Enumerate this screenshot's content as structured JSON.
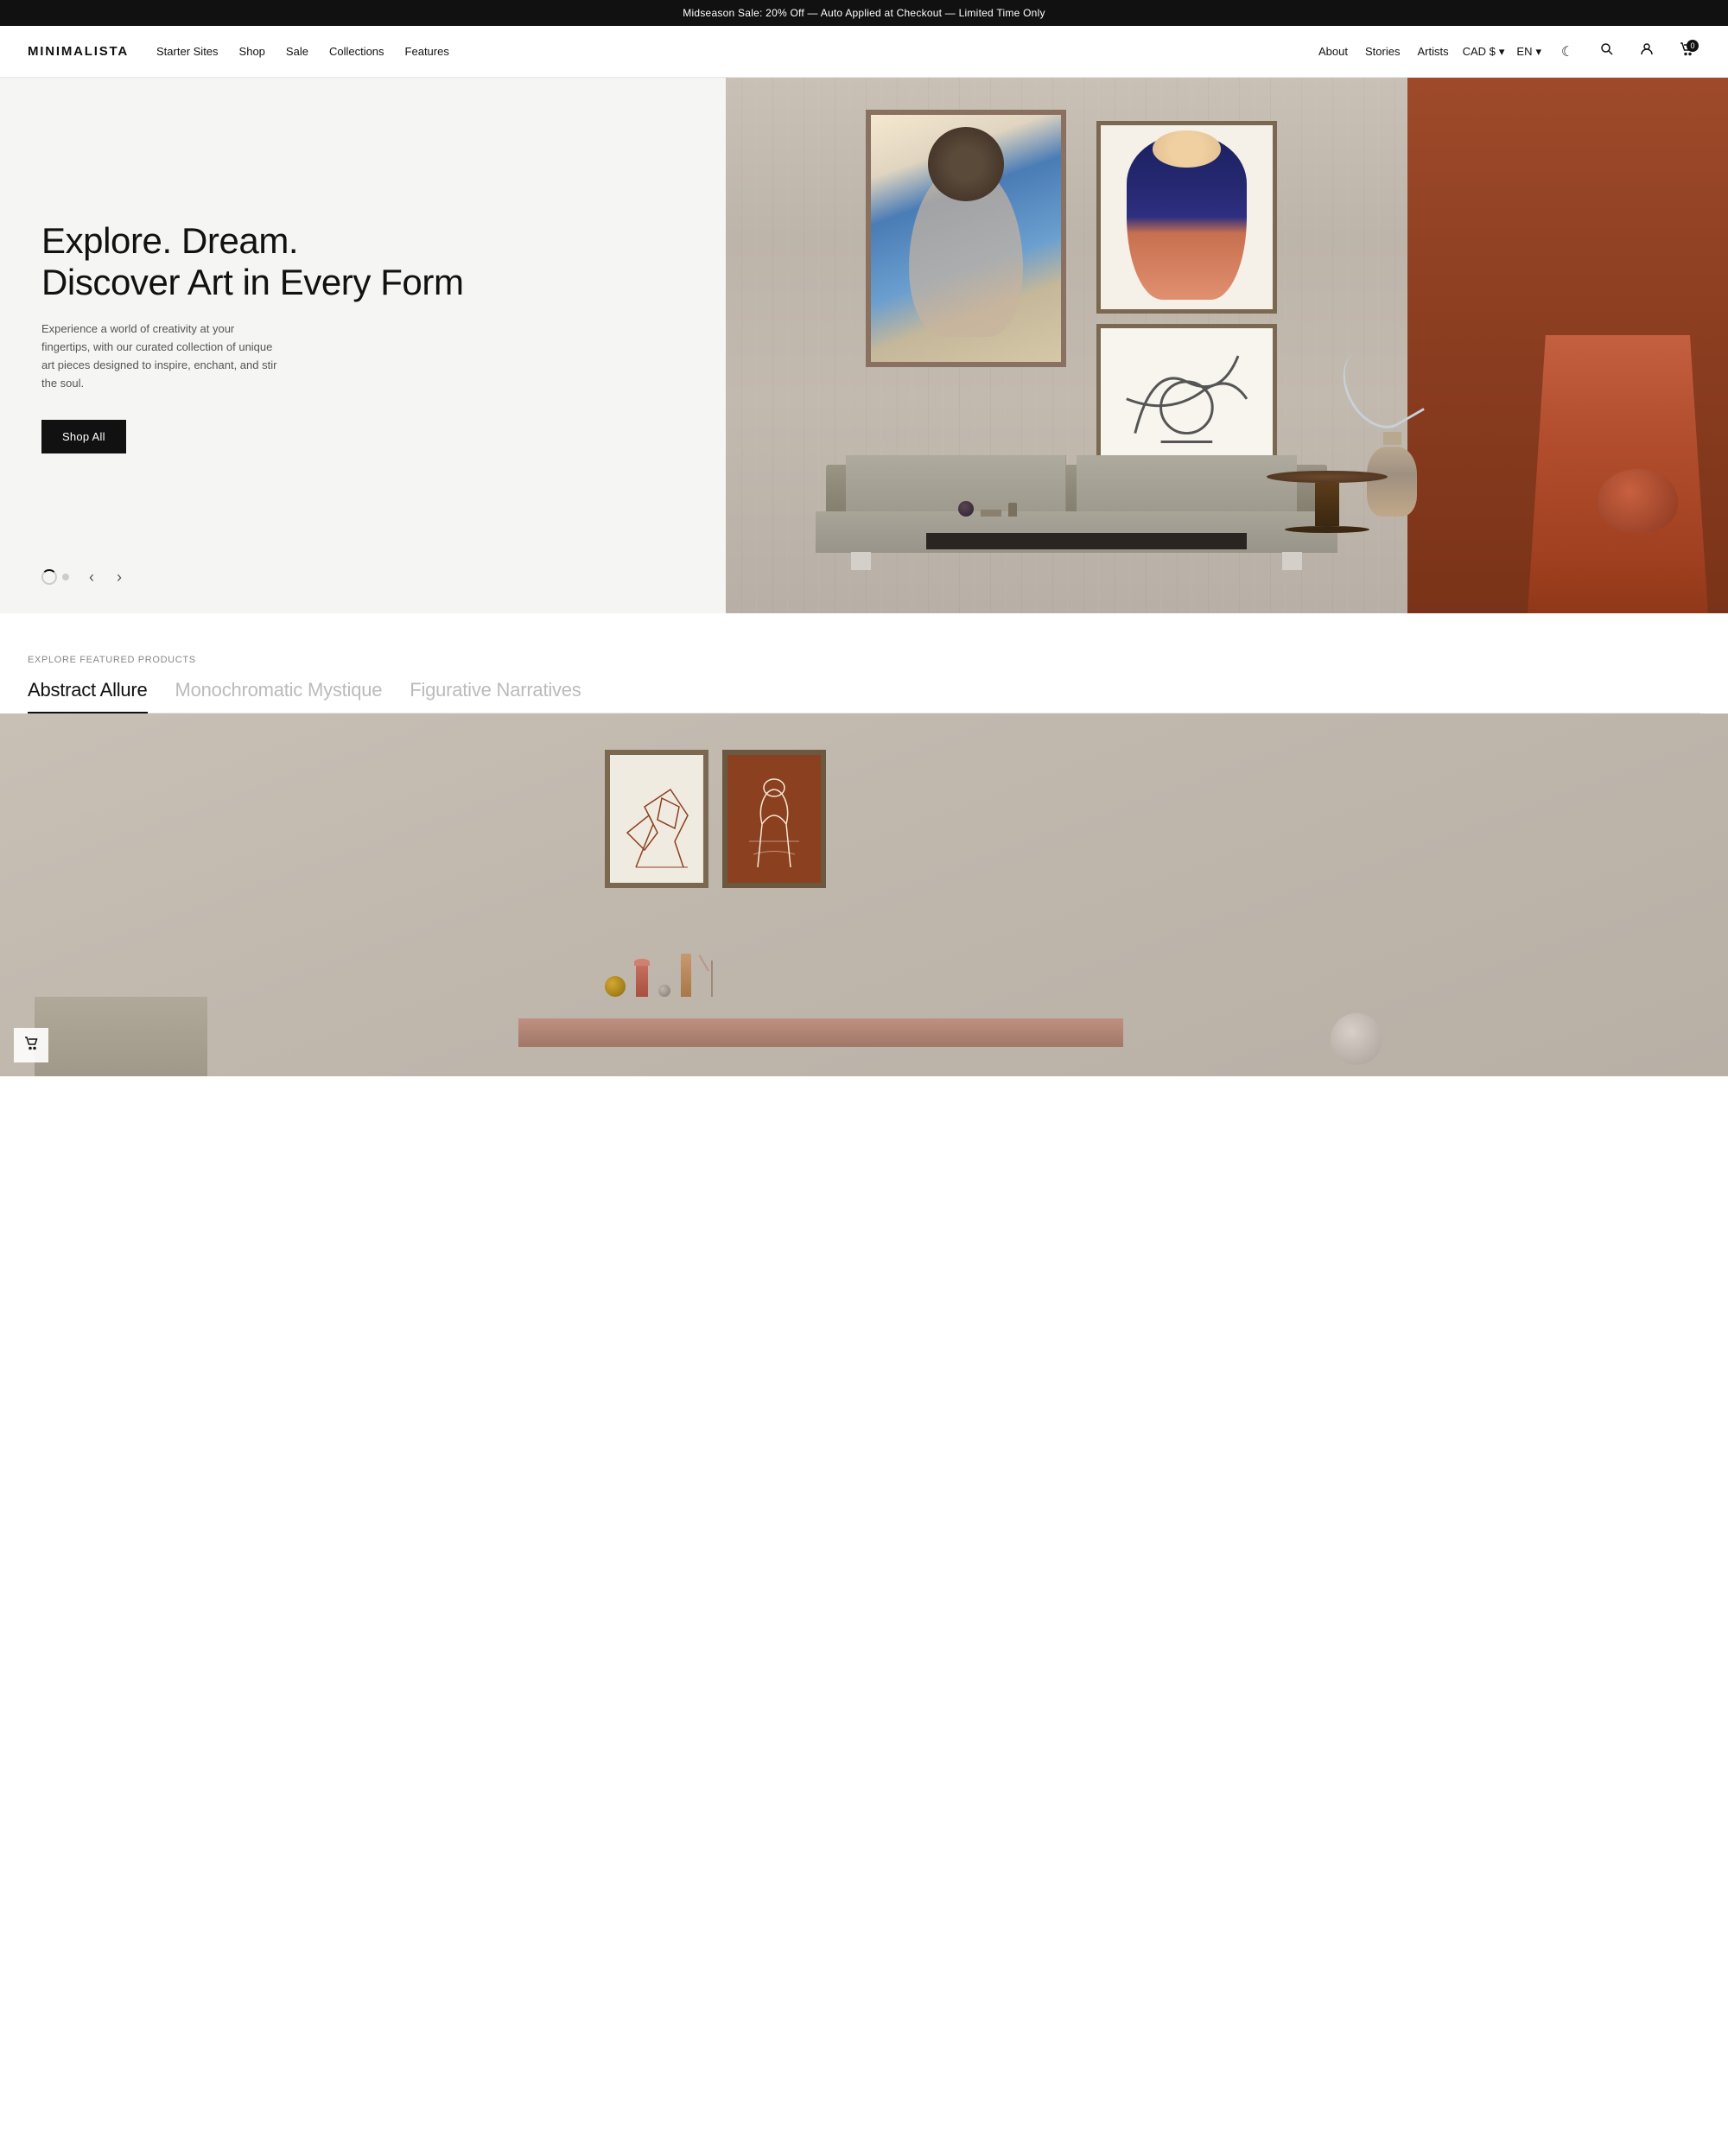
{
  "announcement": {
    "text": "Midseason Sale: 20% Off — Auto Applied at Checkout — Limited Time Only"
  },
  "header": {
    "logo": "MINIMALISTA",
    "nav": {
      "items": [
        {
          "id": "starter-sites",
          "label": "Starter Sites"
        },
        {
          "id": "shop",
          "label": "Shop"
        },
        {
          "id": "sale",
          "label": "Sale"
        },
        {
          "id": "collections",
          "label": "Collections"
        },
        {
          "id": "features",
          "label": "Features"
        }
      ]
    },
    "secondary_nav": {
      "items": [
        {
          "id": "about",
          "label": "About"
        },
        {
          "id": "stories",
          "label": "Stories"
        },
        {
          "id": "artists",
          "label": "Artists"
        }
      ]
    },
    "currency": "CAD $",
    "language": "EN",
    "cart_count": "0",
    "icons": {
      "moon": "☾",
      "search": "⌕",
      "user": "○",
      "cart": "⊡"
    }
  },
  "hero": {
    "title_line1": "Explore. Dream.",
    "title_line2": "Discover Art in Every Form",
    "description": "Experience a world of creativity at your fingertips, with our curated collection of unique art pieces designed to inspire, enchant, and stir the soul.",
    "cta_label": "Shop All",
    "carousel": {
      "dots": [
        {
          "active": true
        },
        {
          "active": false
        }
      ],
      "prev_label": "‹",
      "next_label": "›"
    }
  },
  "featured": {
    "section_label": "Explore Featured Products",
    "tabs": [
      {
        "id": "abstract-allure",
        "label": "Abstract Allure",
        "active": true
      },
      {
        "id": "monochromatic-mystique",
        "label": "Monochromatic Mystique",
        "active": false
      },
      {
        "id": "figurative-narratives",
        "label": "Figurative Narratives",
        "active": false
      }
    ],
    "cart_icon": "🛒"
  }
}
